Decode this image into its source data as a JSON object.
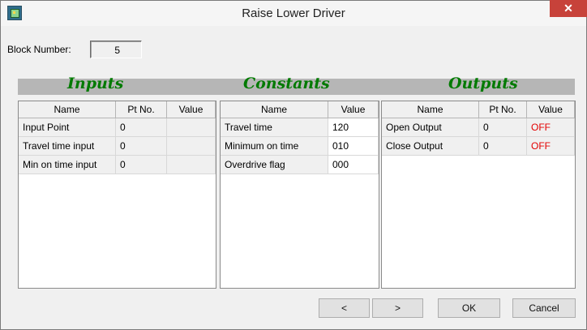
{
  "window": {
    "title": "Raise Lower Driver",
    "close_symbol": "✕"
  },
  "block": {
    "label": "Block Number:",
    "value": "5"
  },
  "sections": {
    "inputs": "Inputs",
    "constants": "Constants",
    "outputs": "Outputs"
  },
  "inputs": {
    "headers": [
      "Name",
      "Pt No.",
      "Value"
    ],
    "rows": [
      {
        "name": "Input Point",
        "pt": "0",
        "value": ""
      },
      {
        "name": "Travel time input",
        "pt": "0",
        "value": ""
      },
      {
        "name": "Min on time input",
        "pt": "0",
        "value": ""
      }
    ]
  },
  "constants": {
    "headers": [
      "Name",
      "Value"
    ],
    "rows": [
      {
        "name": "Travel time",
        "value": "120"
      },
      {
        "name": "Minimum on time",
        "value": "010"
      },
      {
        "name": "Overdrive flag",
        "value": "000"
      }
    ]
  },
  "outputs": {
    "headers": [
      "Name",
      "Pt No.",
      "Value"
    ],
    "rows": [
      {
        "name": "Open Output",
        "pt": "0",
        "value": "OFF"
      },
      {
        "name": "Close Output",
        "pt": "0",
        "value": "OFF"
      }
    ]
  },
  "buttons": {
    "prev": "<",
    "next": ">",
    "ok": "OK",
    "cancel": "Cancel"
  },
  "colors": {
    "section_title": "#007a00",
    "off_value": "#e30000",
    "close_button": "#c7423a"
  }
}
